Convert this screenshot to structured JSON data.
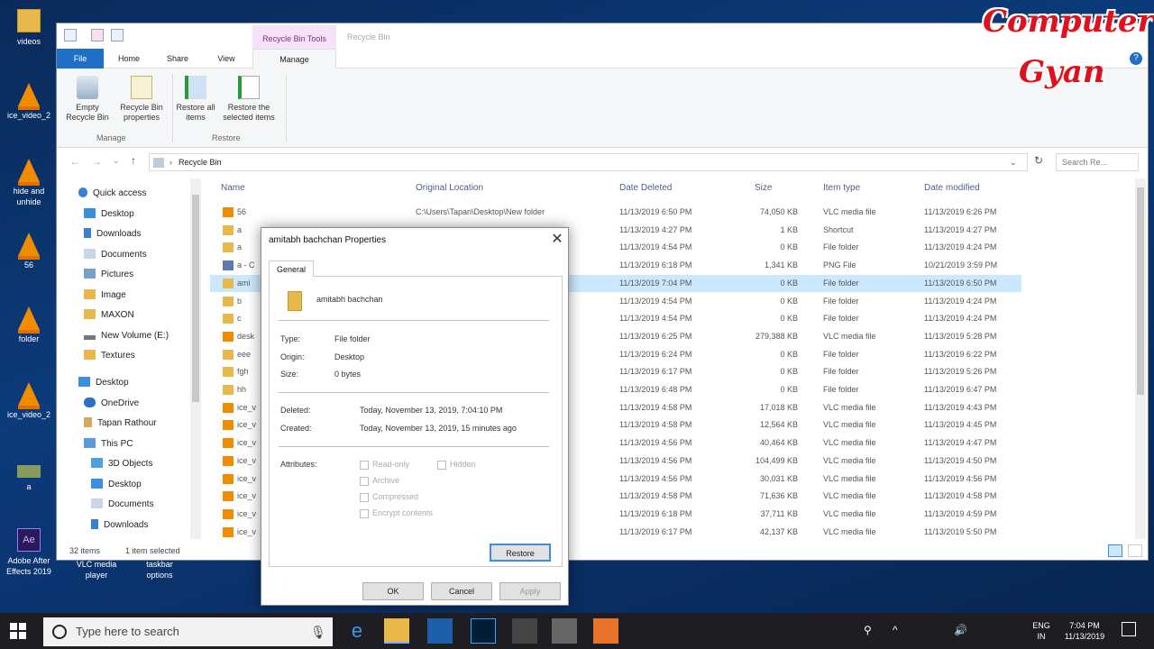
{
  "desktop": {
    "icons": [
      {
        "label": "videos"
      },
      {
        "label": "ice_video_2"
      },
      {
        "label": "hide and unhide"
      },
      {
        "label": "56"
      },
      {
        "label": "folder"
      },
      {
        "label": "ice_video_2"
      },
      {
        "label": "a"
      },
      {
        "label": "Adobe After Effects 2019"
      },
      {
        "label": "VLC media player"
      },
      {
        "label": "taskbar options"
      }
    ]
  },
  "watermark": {
    "line1": "Computer",
    "line2": "Gyan"
  },
  "explorer": {
    "context_tab": "Recycle Bin Tools",
    "title": "Recycle Bin",
    "tabs": {
      "file": "File",
      "home": "Home",
      "share": "Share",
      "view": "View",
      "manage": "Manage"
    },
    "ribbon": {
      "empty": "Empty Recycle Bin",
      "properties": "Recycle Bin properties",
      "restore_all": "Restore all items",
      "restore_sel": "Restore the selected items",
      "group_manage": "Manage",
      "group_restore": "Restore"
    },
    "address": {
      "path": "Recycle Bin",
      "search_placeholder": "Search Re..."
    },
    "nav": [
      {
        "label": "Quick access"
      },
      {
        "label": "Desktop"
      },
      {
        "label": "Downloads"
      },
      {
        "label": "Documents"
      },
      {
        "label": "Pictures"
      },
      {
        "label": "Image"
      },
      {
        "label": "MAXON"
      },
      {
        "label": "New Volume (E:)"
      },
      {
        "label": "Textures"
      },
      {
        "label": "Desktop"
      },
      {
        "label": "OneDrive"
      },
      {
        "label": "Tapan Rathour"
      },
      {
        "label": "This PC"
      },
      {
        "label": "3D Objects"
      },
      {
        "label": "Desktop"
      },
      {
        "label": "Documents"
      },
      {
        "label": "Downloads"
      }
    ],
    "columns": {
      "name": "Name",
      "original": "Original Location",
      "deleted": "Date Deleted",
      "size": "Size",
      "type": "Item type",
      "modified": "Date modified"
    },
    "rows": [
      {
        "name": "56",
        "orig": "C:\\Users\\Tapan\\Desktop\\New folder",
        "deleted": "11/13/2019 6:50 PM",
        "size": "74,050 KB",
        "type": "VLC media file",
        "modified": "11/13/2019 6:26 PM"
      },
      {
        "name": "a",
        "orig": "",
        "deleted": "11/13/2019 4:27 PM",
        "size": "1 KB",
        "type": "Shortcut",
        "modified": "11/13/2019 4:27 PM"
      },
      {
        "name": "a",
        "orig": "",
        "deleted": "11/13/2019 4:54 PM",
        "size": "0 KB",
        "type": "File folder",
        "modified": "11/13/2019 4:24 PM"
      },
      {
        "name": "a - C",
        "orig": "",
        "deleted": "11/13/2019 6:18 PM",
        "size": "1,341 KB",
        "type": "PNG File",
        "modified": "10/21/2019 3:59 PM"
      },
      {
        "name": "ami",
        "orig": "",
        "deleted": "11/13/2019 7:04 PM",
        "size": "0 KB",
        "type": "File folder",
        "modified": "11/13/2019 6:50 PM"
      },
      {
        "name": "b",
        "orig": "",
        "deleted": "11/13/2019 4:54 PM",
        "size": "0 KB",
        "type": "File folder",
        "modified": "11/13/2019 4:24 PM"
      },
      {
        "name": "c",
        "orig": "",
        "deleted": "11/13/2019 4:54 PM",
        "size": "0 KB",
        "type": "File folder",
        "modified": "11/13/2019 4:24 PM"
      },
      {
        "name": "desk",
        "orig": "",
        "deleted": "11/13/2019 6:25 PM",
        "size": "279,388 KB",
        "type": "VLC media file",
        "modified": "11/13/2019 5:28 PM"
      },
      {
        "name": "eee",
        "orig": "",
        "deleted": "11/13/2019 6:24 PM",
        "size": "0 KB",
        "type": "File folder",
        "modified": "11/13/2019 6:22 PM"
      },
      {
        "name": "fgh",
        "orig": "",
        "deleted": "11/13/2019 6:17 PM",
        "size": "0 KB",
        "type": "File folder",
        "modified": "11/13/2019 5:26 PM"
      },
      {
        "name": "hh",
        "orig": "",
        "deleted": "11/13/2019 6:48 PM",
        "size": "0 KB",
        "type": "File folder",
        "modified": "11/13/2019 6:47 PM"
      },
      {
        "name": "ice_v",
        "orig": "",
        "deleted": "11/13/2019 4:58 PM",
        "size": "17,018 KB",
        "type": "VLC media file",
        "modified": "11/13/2019 4:43 PM"
      },
      {
        "name": "ice_v",
        "orig": "",
        "deleted": "11/13/2019 4:58 PM",
        "size": "12,564 KB",
        "type": "VLC media file",
        "modified": "11/13/2019 4:45 PM"
      },
      {
        "name": "ice_v",
        "orig": "",
        "deleted": "11/13/2019 4:56 PM",
        "size": "40,464 KB",
        "type": "VLC media file",
        "modified": "11/13/2019 4:47 PM"
      },
      {
        "name": "ice_v",
        "orig": "",
        "deleted": "11/13/2019 4:56 PM",
        "size": "104,499 KB",
        "type": "VLC media file",
        "modified": "11/13/2019 4:50 PM"
      },
      {
        "name": "ice_v",
        "orig": "",
        "deleted": "11/13/2019 4:56 PM",
        "size": "30,031 KB",
        "type": "VLC media file",
        "modified": "11/13/2019 4:56 PM"
      },
      {
        "name": "ice_v",
        "orig": "",
        "deleted": "11/13/2019 4:58 PM",
        "size": "71,636 KB",
        "type": "VLC media file",
        "modified": "11/13/2019 4:58 PM"
      },
      {
        "name": "ice_v",
        "orig": "",
        "deleted": "11/13/2019 6:18 PM",
        "size": "37,711 KB",
        "type": "VLC media file",
        "modified": "11/13/2019 4:59 PM"
      },
      {
        "name": "ice_v",
        "orig": "",
        "deleted": "11/13/2019 6:17 PM",
        "size": "42,137 KB",
        "type": "VLC media file",
        "modified": "11/13/2019 5:50 PM"
      }
    ],
    "status": {
      "count": "32 items",
      "selected": "1 item selected"
    }
  },
  "dialog": {
    "title": "amitabh bachchan Properties",
    "tab": "General",
    "name": "amitabh bachchan",
    "type_label": "Type:",
    "type_value": "File folder",
    "origin_label": "Origin:",
    "origin_value": "Desktop",
    "size_label": "Size:",
    "size_value": "0 bytes",
    "deleted_label": "Deleted:",
    "deleted_value": "Today, November 13, 2019, 7:04:10 PM",
    "created_label": "Created:",
    "created_value": "Today, November 13, 2019, 15 minutes ago",
    "attributes_label": "Attributes:",
    "attr_readonly": "Read-only",
    "attr_hidden": "Hidden",
    "attr_archive": "Archive",
    "attr_compressed": "Compressed",
    "attr_encrypt": "Encrypt contents",
    "restore": "Restore",
    "ok": "OK",
    "cancel": "Cancel",
    "apply": "Apply"
  },
  "taskbar": {
    "search_placeholder": "Type here to search",
    "lang1": "ENG",
    "lang2": "IN",
    "time": "7:04 PM",
    "date": "11/13/2019"
  }
}
